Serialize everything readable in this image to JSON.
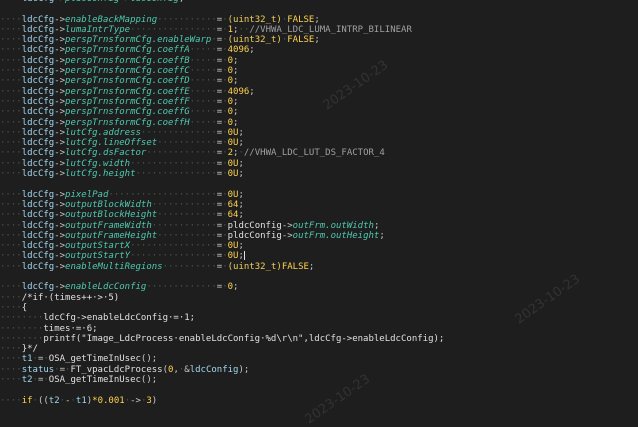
{
  "watermarks": [
    "2023-10-23",
    "2023-10-23",
    "2023-10-23"
  ],
  "lines": [
    [
      [
        "dot",
        "····"
      ],
      [
        "var",
        "ldcCfg"
      ],
      [
        "op",
        "->"
      ],
      [
        "mem",
        "pldcConfig"
      ],
      [
        "op",
        "->"
      ],
      [
        "mem",
        "ldcConfig"
      ],
      [
        "op",
        ";"
      ]
    ],
    [
      [
        "plain",
        ""
      ]
    ],
    [
      [
        "dot",
        "····"
      ],
      [
        "var",
        "ldcCfg"
      ],
      [
        "op",
        "->"
      ],
      [
        "mem",
        "enableBackMapping"
      ],
      [
        "dot",
        "···········"
      ],
      [
        "op",
        "="
      ],
      [
        "dot",
        "·"
      ],
      [
        "type",
        "(uint32_t)"
      ],
      [
        "dot",
        "·"
      ],
      [
        "kw",
        "FALSE"
      ],
      [
        "op",
        ";"
      ]
    ],
    [
      [
        "dot",
        "····"
      ],
      [
        "var",
        "ldcCfg"
      ],
      [
        "op",
        "->"
      ],
      [
        "mem",
        "lumaIntrType"
      ],
      [
        "dot",
        "················"
      ],
      [
        "op",
        "="
      ],
      [
        "dot",
        "·"
      ],
      [
        "num",
        "1"
      ],
      [
        "op",
        ";"
      ],
      [
        "dot",
        "··"
      ],
      [
        "cmt",
        "//VHWA_LDC_LUMA_INTRP_BILINEAR"
      ]
    ],
    [
      [
        "dot",
        "····"
      ],
      [
        "var",
        "ldcCfg"
      ],
      [
        "op",
        "->"
      ],
      [
        "mem",
        "perspTrnsformCfg.enableWarp"
      ],
      [
        "dot",
        "·"
      ],
      [
        "op",
        "="
      ],
      [
        "dot",
        "·"
      ],
      [
        "type",
        "(uint32_t)"
      ],
      [
        "dot",
        "·"
      ],
      [
        "kw",
        "FALSE"
      ],
      [
        "op",
        ";"
      ]
    ],
    [
      [
        "dot",
        "····"
      ],
      [
        "var",
        "ldcCfg"
      ],
      [
        "op",
        "->"
      ],
      [
        "mem",
        "perspTrnsformCfg.coeffA"
      ],
      [
        "dot",
        "·····"
      ],
      [
        "op",
        "="
      ],
      [
        "dot",
        "·"
      ],
      [
        "num",
        "4096"
      ],
      [
        "op",
        ";"
      ]
    ],
    [
      [
        "dot",
        "····"
      ],
      [
        "var",
        "ldcCfg"
      ],
      [
        "op",
        "->"
      ],
      [
        "mem",
        "perspTrnsformCfg.coeffB"
      ],
      [
        "dot",
        "·····"
      ],
      [
        "op",
        "="
      ],
      [
        "dot",
        "·"
      ],
      [
        "num",
        "0"
      ],
      [
        "op",
        ";"
      ]
    ],
    [
      [
        "dot",
        "····"
      ],
      [
        "var",
        "ldcCfg"
      ],
      [
        "op",
        "->"
      ],
      [
        "mem",
        "perspTrnsformCfg.coeffC"
      ],
      [
        "dot",
        "·····"
      ],
      [
        "op",
        "="
      ],
      [
        "dot",
        "·"
      ],
      [
        "num",
        "0"
      ],
      [
        "op",
        ";"
      ]
    ],
    [
      [
        "dot",
        "····"
      ],
      [
        "var",
        "ldcCfg"
      ],
      [
        "op",
        "->"
      ],
      [
        "mem",
        "perspTrnsformCfg.coeffD"
      ],
      [
        "dot",
        "·····"
      ],
      [
        "op",
        "="
      ],
      [
        "dot",
        "·"
      ],
      [
        "num",
        "0"
      ],
      [
        "op",
        ";"
      ]
    ],
    [
      [
        "dot",
        "····"
      ],
      [
        "var",
        "ldcCfg"
      ],
      [
        "op",
        "->"
      ],
      [
        "mem",
        "perspTrnsformCfg.coeffE"
      ],
      [
        "dot",
        "·····"
      ],
      [
        "op",
        "="
      ],
      [
        "dot",
        "·"
      ],
      [
        "num",
        "4096"
      ],
      [
        "op",
        ";"
      ]
    ],
    [
      [
        "dot",
        "····"
      ],
      [
        "var",
        "ldcCfg"
      ],
      [
        "op",
        "->"
      ],
      [
        "mem",
        "perspTrnsformCfg.coeffF"
      ],
      [
        "dot",
        "·····"
      ],
      [
        "op",
        "="
      ],
      [
        "dot",
        "·"
      ],
      [
        "num",
        "0"
      ],
      [
        "op",
        ";"
      ]
    ],
    [
      [
        "dot",
        "····"
      ],
      [
        "var",
        "ldcCfg"
      ],
      [
        "op",
        "->"
      ],
      [
        "mem",
        "perspTrnsformCfg.coeffG"
      ],
      [
        "dot",
        "·····"
      ],
      [
        "op",
        "="
      ],
      [
        "dot",
        "·"
      ],
      [
        "num",
        "0"
      ],
      [
        "op",
        ";"
      ]
    ],
    [
      [
        "dot",
        "····"
      ],
      [
        "var",
        "ldcCfg"
      ],
      [
        "op",
        "->"
      ],
      [
        "mem",
        "perspTrnsformCfg.coeffH"
      ],
      [
        "dot",
        "·····"
      ],
      [
        "op",
        "="
      ],
      [
        "dot",
        "·"
      ],
      [
        "num",
        "0"
      ],
      [
        "op",
        ";"
      ]
    ],
    [
      [
        "dot",
        "····"
      ],
      [
        "var",
        "ldcCfg"
      ],
      [
        "op",
        "->"
      ],
      [
        "mem",
        "lutCfg.address"
      ],
      [
        "dot",
        "··············"
      ],
      [
        "op",
        "="
      ],
      [
        "dot",
        "·"
      ],
      [
        "num",
        "0U"
      ],
      [
        "op",
        ";"
      ]
    ],
    [
      [
        "dot",
        "····"
      ],
      [
        "var",
        "ldcCfg"
      ],
      [
        "op",
        "->"
      ],
      [
        "mem",
        "lutCfg.lineOffset"
      ],
      [
        "dot",
        "···········"
      ],
      [
        "op",
        "="
      ],
      [
        "dot",
        "·"
      ],
      [
        "num",
        "0U"
      ],
      [
        "op",
        ";"
      ]
    ],
    [
      [
        "dot",
        "····"
      ],
      [
        "var",
        "ldcCfg"
      ],
      [
        "op",
        "->"
      ],
      [
        "mem",
        "lutCfg.dsFactor"
      ],
      [
        "dot",
        "·············"
      ],
      [
        "op",
        "="
      ],
      [
        "dot",
        "·"
      ],
      [
        "num",
        "2"
      ],
      [
        "op",
        ";"
      ],
      [
        "dot",
        "·"
      ],
      [
        "cmt",
        "//VHWA_LDC_LUT_DS_FACTOR_4"
      ]
    ],
    [
      [
        "dot",
        "····"
      ],
      [
        "var",
        "ldcCfg"
      ],
      [
        "op",
        "->"
      ],
      [
        "mem",
        "lutCfg.width"
      ],
      [
        "dot",
        "················"
      ],
      [
        "op",
        "="
      ],
      [
        "dot",
        "·"
      ],
      [
        "num",
        "0U"
      ],
      [
        "op",
        ";"
      ]
    ],
    [
      [
        "dot",
        "····"
      ],
      [
        "var",
        "ldcCfg"
      ],
      [
        "op",
        "->"
      ],
      [
        "mem",
        "lutCfg.height"
      ],
      [
        "dot",
        "···············"
      ],
      [
        "op",
        "="
      ],
      [
        "dot",
        "·"
      ],
      [
        "num",
        "0U"
      ],
      [
        "op",
        ";"
      ]
    ],
    [
      [
        "plain",
        ""
      ]
    ],
    [
      [
        "dot",
        "····"
      ],
      [
        "var",
        "ldcCfg"
      ],
      [
        "op",
        "->"
      ],
      [
        "mem",
        "pixelPad"
      ],
      [
        "dot",
        "····················"
      ],
      [
        "op",
        "="
      ],
      [
        "dot",
        "·"
      ],
      [
        "num",
        "0U"
      ],
      [
        "op",
        ";"
      ]
    ],
    [
      [
        "dot",
        "····"
      ],
      [
        "var",
        "ldcCfg"
      ],
      [
        "op",
        "->"
      ],
      [
        "mem",
        "outputBlockWidth"
      ],
      [
        "dot",
        "············"
      ],
      [
        "op",
        "="
      ],
      [
        "dot",
        "·"
      ],
      [
        "num",
        "64"
      ],
      [
        "op",
        ";"
      ]
    ],
    [
      [
        "dot",
        "····"
      ],
      [
        "var",
        "ldcCfg"
      ],
      [
        "op",
        "->"
      ],
      [
        "mem",
        "outputBlockHeight"
      ],
      [
        "dot",
        "···········"
      ],
      [
        "op",
        "="
      ],
      [
        "dot",
        "·"
      ],
      [
        "num",
        "64"
      ],
      [
        "op",
        ";"
      ]
    ],
    [
      [
        "dot",
        "····"
      ],
      [
        "var",
        "ldcCfg"
      ],
      [
        "op",
        "->"
      ],
      [
        "mem",
        "outputFrameWidth"
      ],
      [
        "dot",
        "············"
      ],
      [
        "op",
        "="
      ],
      [
        "dot",
        "·"
      ],
      [
        "plain",
        "pldcConfig"
      ],
      [
        "op",
        "->"
      ],
      [
        "mem",
        "outFrm.outWidth"
      ],
      [
        "op",
        ";"
      ]
    ],
    [
      [
        "dot",
        "····"
      ],
      [
        "var",
        "ldcCfg"
      ],
      [
        "op",
        "->"
      ],
      [
        "mem",
        "outputFrameHeight"
      ],
      [
        "dot",
        "···········"
      ],
      [
        "op",
        "="
      ],
      [
        "dot",
        "·"
      ],
      [
        "plain",
        "pldcConfig"
      ],
      [
        "op",
        "->"
      ],
      [
        "mem",
        "outFrm.outHeight"
      ],
      [
        "op",
        ";"
      ]
    ],
    [
      [
        "dot",
        "····"
      ],
      [
        "var",
        "ldcCfg"
      ],
      [
        "op",
        "->"
      ],
      [
        "mem",
        "outputStartX"
      ],
      [
        "dot",
        "················"
      ],
      [
        "op",
        "="
      ],
      [
        "dot",
        "·"
      ],
      [
        "num",
        "0U"
      ],
      [
        "op",
        ";"
      ]
    ],
    [
      [
        "dot",
        "····"
      ],
      [
        "var",
        "ldcCfg"
      ],
      [
        "op",
        "->"
      ],
      [
        "mem",
        "outputStartY"
      ],
      [
        "dot",
        "················"
      ],
      [
        "op",
        "="
      ],
      [
        "dot",
        "·"
      ],
      [
        "num",
        "0U"
      ],
      [
        "op",
        ";"
      ],
      [
        "cursor",
        ""
      ]
    ],
    [
      [
        "dot",
        "····"
      ],
      [
        "var",
        "ldcCfg"
      ],
      [
        "op",
        "->"
      ],
      [
        "mem",
        "enableMultiRegions"
      ],
      [
        "dot",
        "··········"
      ],
      [
        "op",
        "="
      ],
      [
        "dot",
        "·"
      ],
      [
        "type",
        "(uint32_t)"
      ],
      [
        "kw",
        "FALSE"
      ],
      [
        "op",
        ";"
      ]
    ],
    [
      [
        "plain",
        ""
      ]
    ],
    [
      [
        "dot",
        "····"
      ],
      [
        "var",
        "ldcCfg"
      ],
      [
        "op",
        "->"
      ],
      [
        "mem",
        "enableLdcConfig"
      ],
      [
        "dot",
        "·············"
      ],
      [
        "op",
        "="
      ],
      [
        "dot",
        "·"
      ],
      [
        "num",
        "0"
      ],
      [
        "op",
        ";"
      ]
    ],
    [
      [
        "dot",
        "····"
      ],
      [
        "com",
        "/*if·(times++·>·5)"
      ]
    ],
    [
      [
        "dot",
        "····"
      ],
      [
        "com",
        "{"
      ]
    ],
    [
      [
        "dot",
        "········"
      ],
      [
        "com",
        "ldcCfg->enableLdcConfig·=·1;"
      ]
    ],
    [
      [
        "dot",
        "········"
      ],
      [
        "com",
        "times·=·6;"
      ]
    ],
    [
      [
        "dot",
        "········"
      ],
      [
        "com",
        "printf(\"Image_LdcProcess·enableLdcConfig·%d\\r\\n\",ldcCfg->enableLdcConfig);"
      ]
    ],
    [
      [
        "dot",
        "····"
      ],
      [
        "com",
        "}*/"
      ]
    ],
    [
      [
        "dot",
        "····"
      ],
      [
        "var",
        "t1"
      ],
      [
        "dot",
        "·"
      ],
      [
        "op",
        "="
      ],
      [
        "dot",
        "·"
      ],
      [
        "fn",
        "OSA_getTimeInUsec"
      ],
      [
        "op",
        "();"
      ]
    ],
    [
      [
        "dot",
        "····"
      ],
      [
        "var",
        "status"
      ],
      [
        "dot",
        "·"
      ],
      [
        "op",
        "="
      ],
      [
        "dot",
        "·"
      ],
      [
        "fn",
        "FT_vpacLdcProcess"
      ],
      [
        "op",
        "("
      ],
      [
        "num",
        "0"
      ],
      [
        "op",
        ","
      ],
      [
        "dot",
        "·"
      ],
      [
        "op",
        "&"
      ],
      [
        "var",
        "ldcConfig"
      ],
      [
        "op",
        ");"
      ]
    ],
    [
      [
        "dot",
        "····"
      ],
      [
        "var",
        "t2"
      ],
      [
        "dot",
        "·"
      ],
      [
        "op",
        "="
      ],
      [
        "dot",
        "·"
      ],
      [
        "fn",
        "OSA_getTimeInUsec"
      ],
      [
        "op",
        "();"
      ]
    ],
    [
      [
        "plain",
        ""
      ]
    ],
    [
      [
        "dot",
        "····"
      ],
      [
        "kw",
        "if"
      ],
      [
        "dot",
        "·"
      ],
      [
        "op",
        "(("
      ],
      [
        "var",
        "t2"
      ],
      [
        "dot",
        "·"
      ],
      [
        "op",
        "-"
      ],
      [
        "dot",
        "·"
      ],
      [
        "var",
        "t1"
      ],
      [
        "op",
        ")"
      ],
      [
        "num",
        "*0.001"
      ],
      [
        "dot",
        "·"
      ],
      [
        "op",
        "->"
      ],
      [
        "dot",
        "·"
      ],
      [
        "num",
        "3"
      ],
      [
        "op",
        ")"
      ]
    ]
  ]
}
